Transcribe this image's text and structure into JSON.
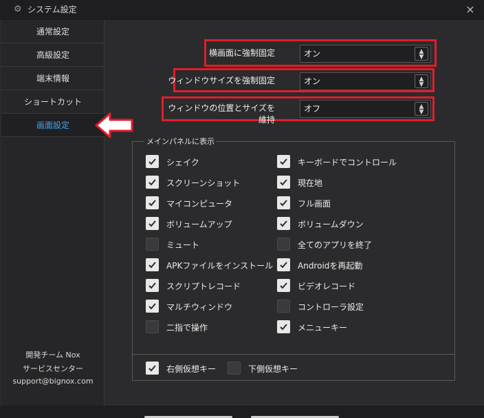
{
  "window": {
    "title": "システム設定",
    "close_glyph": "×",
    "icon": "gear-icon"
  },
  "sidebar": {
    "items": [
      {
        "label": "通常設定",
        "active": false
      },
      {
        "label": "高級設定",
        "active": false
      },
      {
        "label": "端末情報",
        "active": false
      },
      {
        "label": "ショートカット",
        "active": false
      },
      {
        "label": "画面設定",
        "active": true
      }
    ],
    "footer": [
      "開発チーム Nox",
      "サービスセンター",
      "support@bignox.com"
    ]
  },
  "settings": [
    {
      "label": "横画面に強制固定",
      "value": "オン"
    },
    {
      "label": "ウィンドウサイズを強制固定",
      "value": "オン"
    },
    {
      "label": "ウィンドウの位置とサイズを維持",
      "value": "オフ"
    }
  ],
  "main_panel": {
    "title": "メインパネルに表示",
    "left": [
      {
        "label": "シェイク",
        "checked": true
      },
      {
        "label": "スクリーンショット",
        "checked": true
      },
      {
        "label": "マイコンピュータ",
        "checked": true
      },
      {
        "label": "ボリュームアップ",
        "checked": true
      },
      {
        "label": "ミュート",
        "checked": false
      },
      {
        "label": "APKファイルをインストール",
        "checked": true
      },
      {
        "label": "スクリプトレコード",
        "checked": true
      },
      {
        "label": "マルチウィンドウ",
        "checked": true
      },
      {
        "label": "二指で操作",
        "checked": false
      }
    ],
    "right": [
      {
        "label": "キーボードでコントロール",
        "checked": true
      },
      {
        "label": "現在地",
        "checked": true
      },
      {
        "label": "フル画面",
        "checked": true
      },
      {
        "label": "ボリュームダウン",
        "checked": true
      },
      {
        "label": "全てのアプリを終了",
        "checked": false
      },
      {
        "label": "Androidを再起動",
        "checked": true
      },
      {
        "label": "ビデオレコード",
        "checked": true
      },
      {
        "label": "コントローラ設定",
        "checked": false
      },
      {
        "label": "メニューキー",
        "checked": true
      }
    ],
    "virtual_keys": [
      {
        "label": "右側仮想キー",
        "checked": true
      },
      {
        "label": "下側仮想キー",
        "checked": false
      }
    ]
  },
  "colors": {
    "highlight": "#e01e2b",
    "active_nav": "#3aa8f0",
    "background": "#2b2b2d"
  }
}
